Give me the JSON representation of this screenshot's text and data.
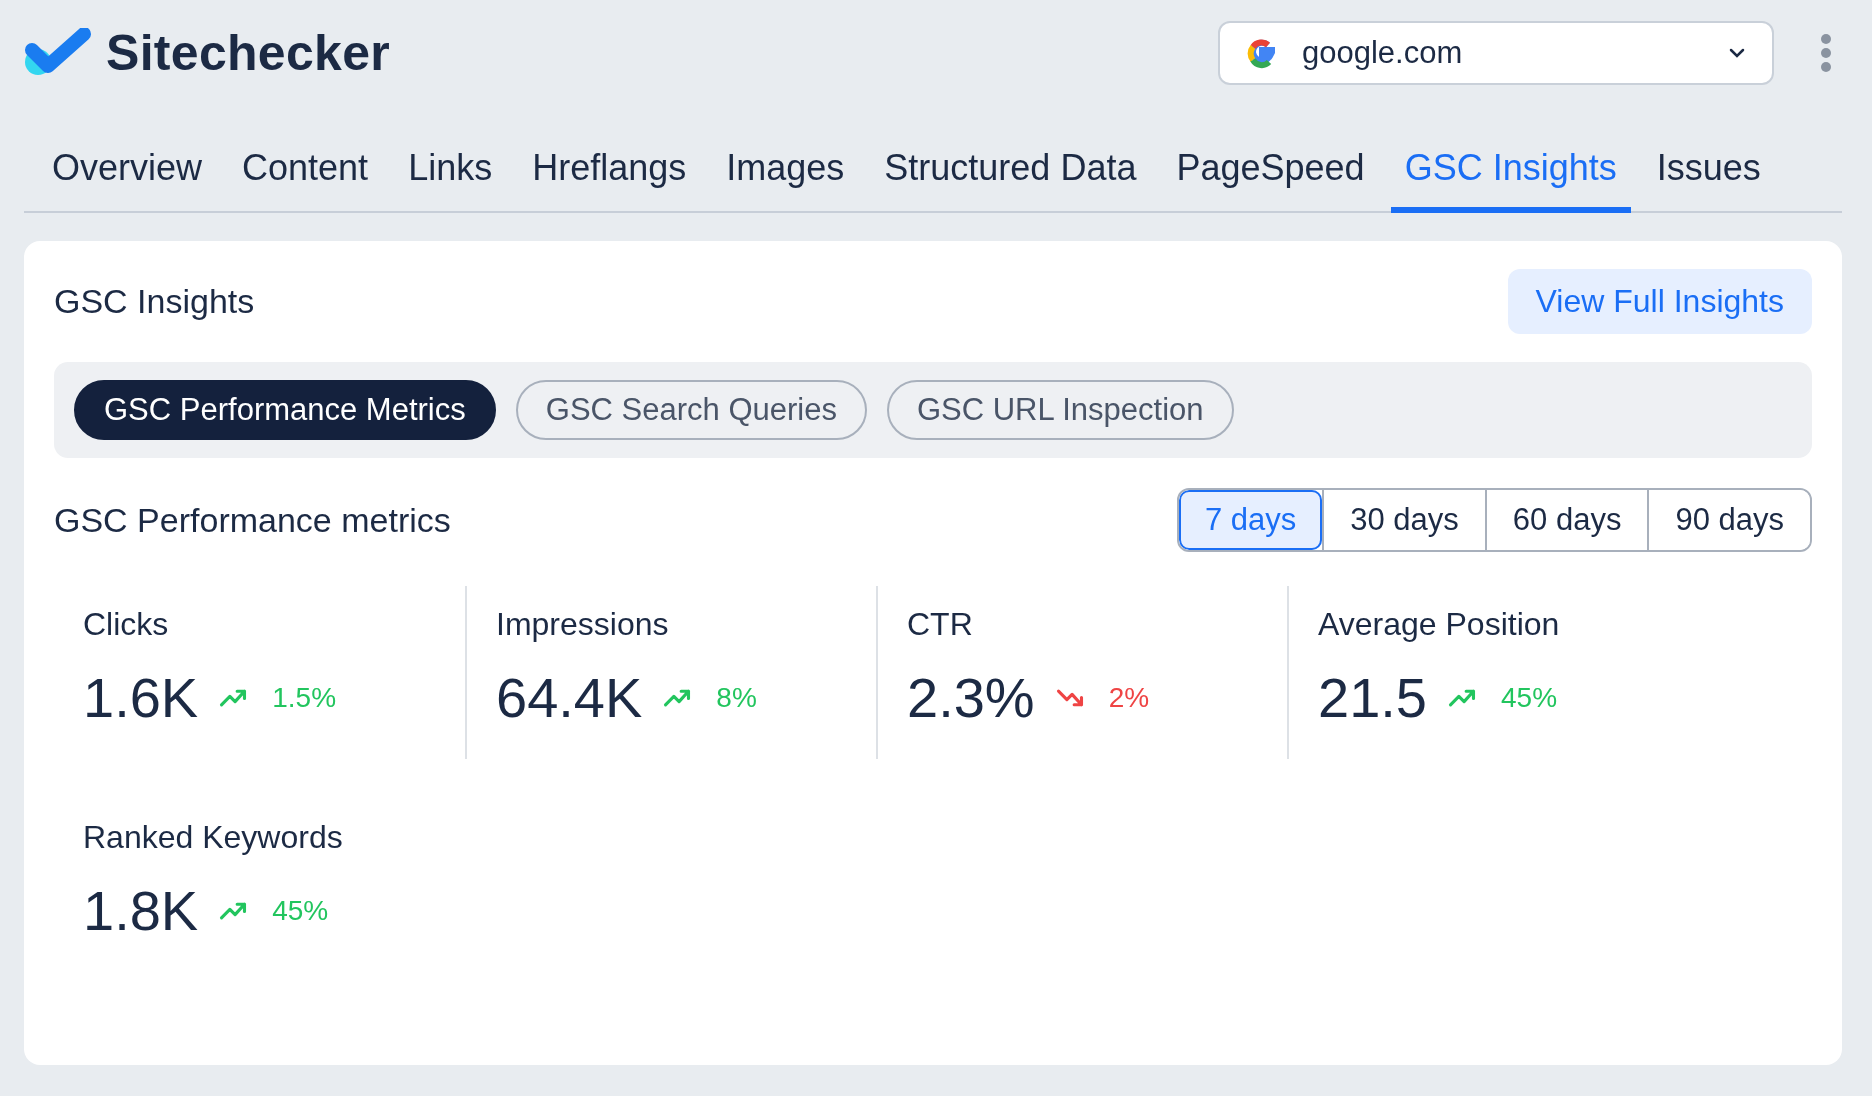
{
  "brand": {
    "name": "Sitechecker"
  },
  "domain_select": {
    "value": "google.com"
  },
  "tabs": [
    {
      "label": "Overview",
      "selected": false
    },
    {
      "label": "Content",
      "selected": false
    },
    {
      "label": "Links",
      "selected": false
    },
    {
      "label": "Hreflangs",
      "selected": false
    },
    {
      "label": "Images",
      "selected": false
    },
    {
      "label": "Structured Data",
      "selected": false
    },
    {
      "label": "PageSpeed",
      "selected": false
    },
    {
      "label": "GSC Insights",
      "selected": true
    },
    {
      "label": "Issues",
      "selected": false
    }
  ],
  "card": {
    "title": "GSC Insights",
    "action_button": "View Full Insights",
    "subtabs": [
      {
        "label": "GSC Performance Metrics",
        "selected": true
      },
      {
        "label": "GSC Search Queries",
        "selected": false
      },
      {
        "label": "GSC URL Inspection",
        "selected": false
      }
    ],
    "section_title": "GSC Performance metrics",
    "periods": [
      {
        "label": "7 days",
        "selected": true
      },
      {
        "label": "30 days",
        "selected": false
      },
      {
        "label": "60 days",
        "selected": false
      },
      {
        "label": "90 days",
        "selected": false
      }
    ],
    "metrics": [
      {
        "label": "Clicks",
        "value": "1.6K",
        "change": "1.5%",
        "kind": "up"
      },
      {
        "label": "Impressions",
        "value": "64.4K",
        "change": "8%",
        "kind": "up"
      },
      {
        "label": "CTR",
        "value": "2.3%",
        "change": "2%",
        "kind": "down"
      },
      {
        "label": "Average Position",
        "value": "21.5",
        "change": "45%",
        "kind": "up"
      }
    ],
    "extra_metrics": [
      {
        "label": "Ranked Keywords",
        "value": "1.8K",
        "change": "45%",
        "kind": "up"
      }
    ]
  }
}
